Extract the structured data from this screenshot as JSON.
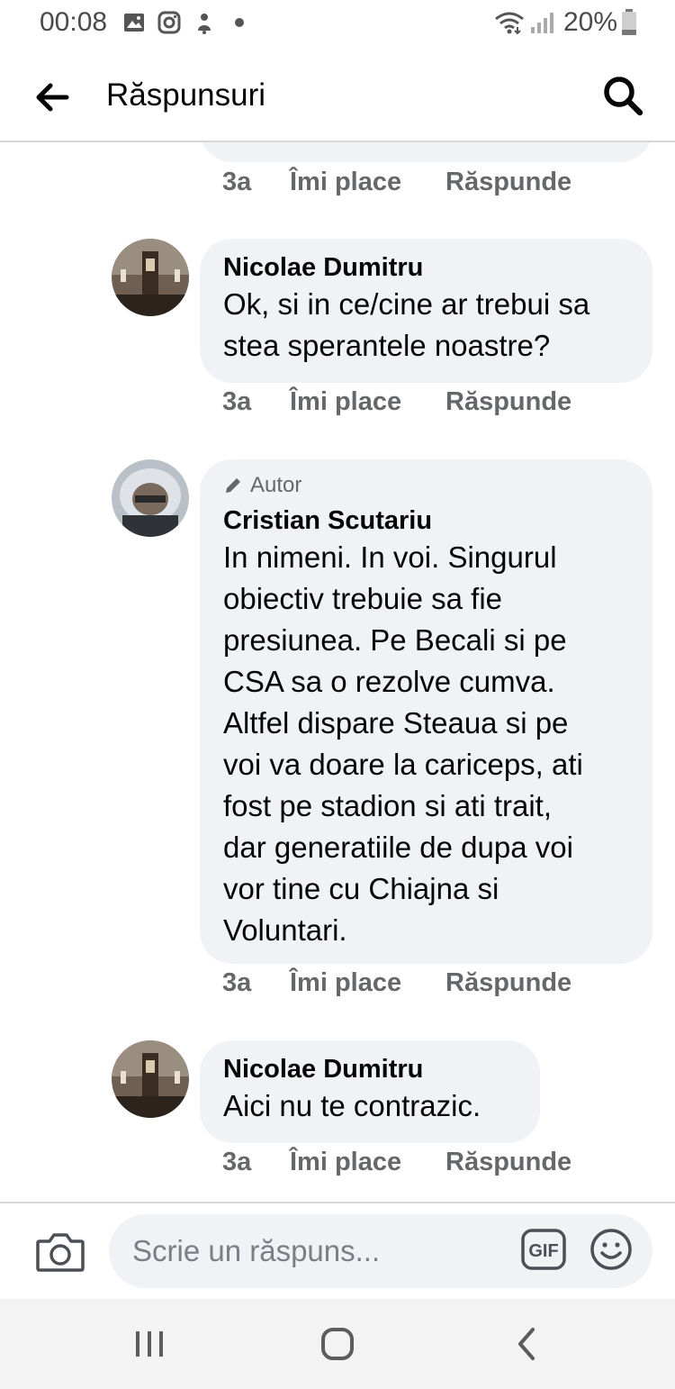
{
  "status_bar": {
    "time": "00:08",
    "battery": "20%",
    "icons": [
      "gallery-icon",
      "instagram-icon",
      "notification-icon",
      "wifi-icon",
      "signal-icon",
      "battery-icon"
    ]
  },
  "header": {
    "title": "Răspunsuri",
    "back_icon": "back-arrow-icon",
    "search_icon": "search-icon"
  },
  "thread": {
    "previous_comment_actions": {
      "time": "3a",
      "like": "Îmi place",
      "reply": "Răspunde"
    },
    "comments": [
      {
        "author": "Nicolae Dumitru",
        "text_lines": [
          "Ok, si in ce/cine ar trebui sa",
          "stea sperantele noastre?"
        ],
        "time": "3a",
        "like": "Îmi place",
        "reply": "Răspunde"
      },
      {
        "badge": "Autor",
        "author": "Cristian Scutariu",
        "text_lines": [
          "In nimeni. In voi. Singurul",
          "obiectiv trebuie sa fie",
          "presiunea. Pe Becali si pe",
          "CSA sa o rezolve cumva.",
          "Altfel dispare Steaua si pe",
          "voi va doare la cariceps, ati",
          "fost pe stadion si ati trait,",
          "dar generatiile de dupa voi",
          "vor tine cu Chiajna si",
          "Voluntari."
        ],
        "time": "3a",
        "like": "Îmi place",
        "reply": "Răspunde"
      },
      {
        "author": "Nicolae Dumitru",
        "text_lines": [
          "Aici nu te contrazic."
        ],
        "time": "3a",
        "like": "Îmi place",
        "reply": "Răspunde"
      }
    ]
  },
  "composer": {
    "placeholder": "Scrie un răspuns...",
    "gif_label": "GIF"
  },
  "colors": {
    "bubble": "#f0f2f5",
    "secondary_text": "#65676b",
    "primary_text": "#050505"
  }
}
